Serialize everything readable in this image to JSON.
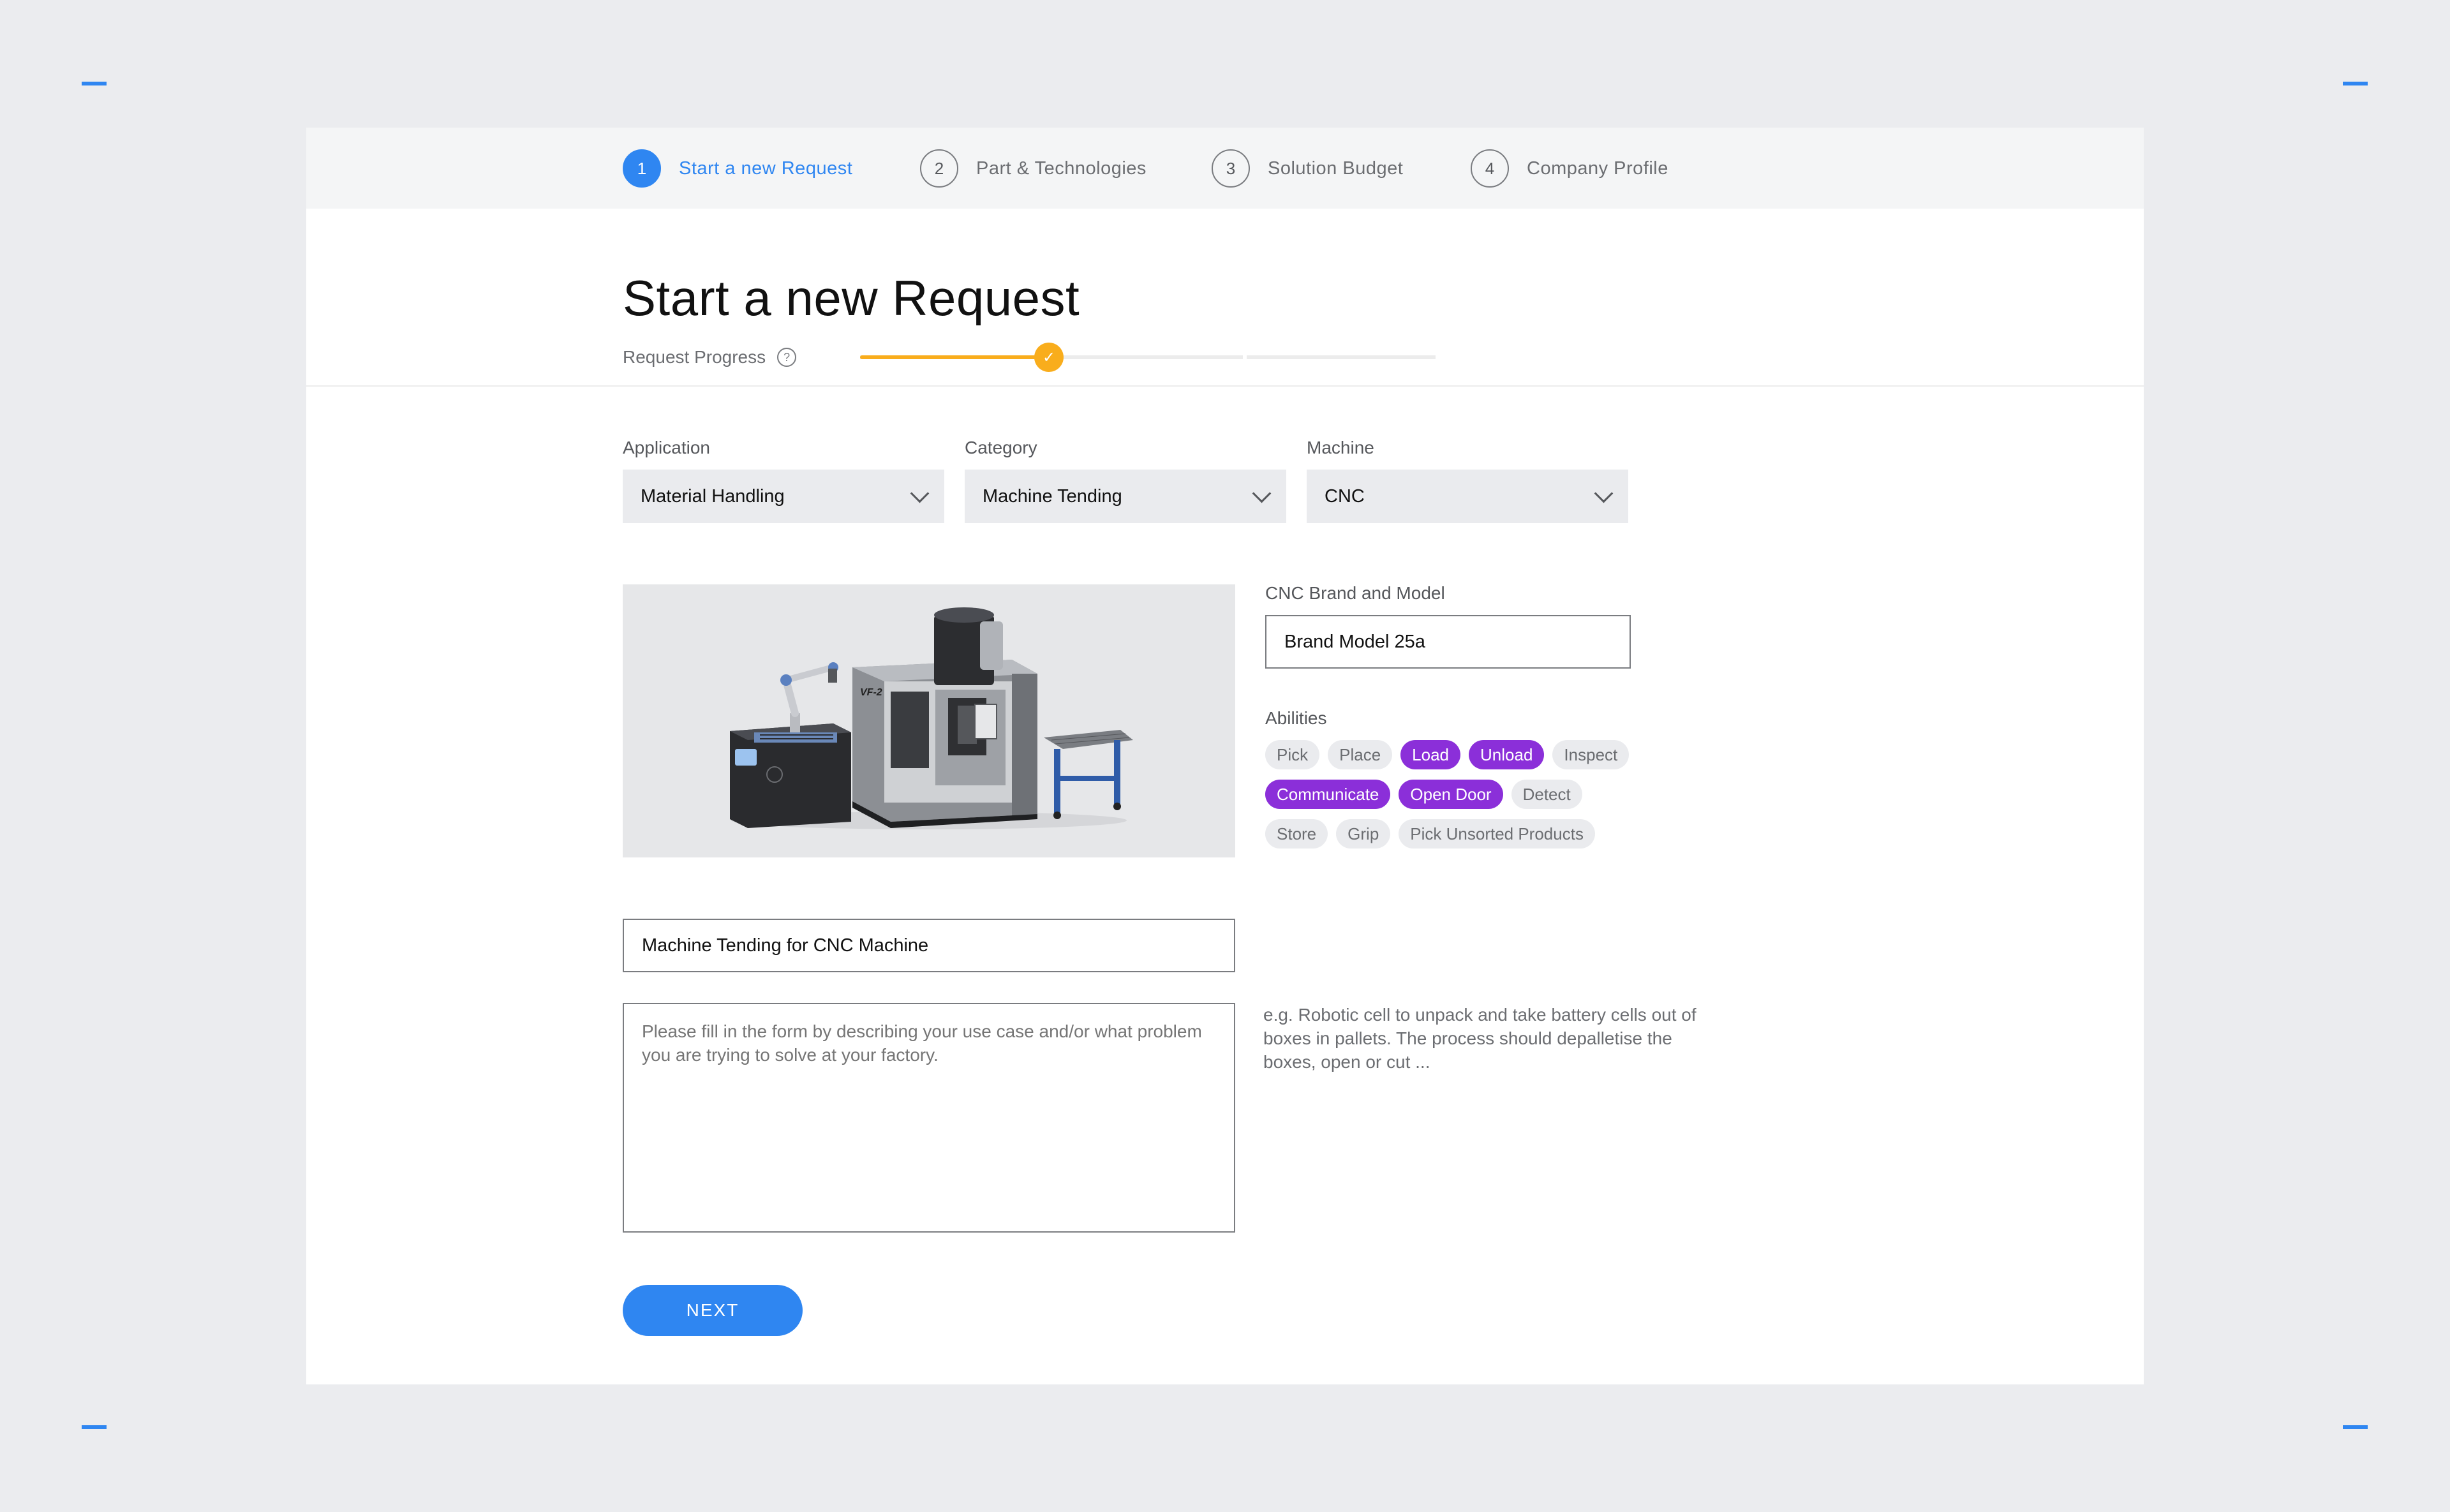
{
  "steps": [
    {
      "num": "1",
      "label": "Start a new Request"
    },
    {
      "num": "2",
      "label": "Part & Technologies"
    },
    {
      "num": "3",
      "label": "Solution Budget"
    },
    {
      "num": "4",
      "label": "Company Profile"
    }
  ],
  "header": {
    "title": "Start a new Request",
    "progress_label": "Request Progress",
    "progress_icon": "check-icon",
    "help_icon": "question-circle-icon"
  },
  "selects": {
    "application": {
      "label": "Application",
      "value": "Material Handling"
    },
    "category": {
      "label": "Category",
      "value": "Machine Tending"
    },
    "machine": {
      "label": "Machine",
      "value": "CNC"
    }
  },
  "brand": {
    "label": "CNC Brand and Model",
    "value": "Brand Model 25a"
  },
  "image": {
    "label": "VF-2"
  },
  "abilities": {
    "label": "Abilities",
    "rows": [
      [
        {
          "label": "Pick",
          "selected": false
        },
        {
          "label": "Place",
          "selected": false
        },
        {
          "label": "Load",
          "selected": true
        },
        {
          "label": "Unload",
          "selected": true
        },
        {
          "label": "Inspect",
          "selected": false
        }
      ],
      [
        {
          "label": "Communicate",
          "selected": true
        },
        {
          "label": "Open Door",
          "selected": true
        },
        {
          "label": "Detect",
          "selected": false
        }
      ],
      [
        {
          "label": "Store",
          "selected": false
        },
        {
          "label": "Grip",
          "selected": false
        },
        {
          "label": "Pick Unsorted Products",
          "selected": false
        }
      ]
    ]
  },
  "request_title": {
    "value": "Machine Tending for CNC Machine"
  },
  "description": {
    "placeholder": "Please fill in the form by describing your use case and/or what problem you are trying to solve at your factory."
  },
  "hint": {
    "text": "e.g. Robotic cell to unpack and take battery cells out of boxes in pallets. The process should depalletise the boxes, open or cut ..."
  },
  "actions": {
    "next_label": "NEXT"
  },
  "colors": {
    "accent": "#2f86f1",
    "progress": "#f9ad1c",
    "chip_selected": "#8b2fd9"
  }
}
